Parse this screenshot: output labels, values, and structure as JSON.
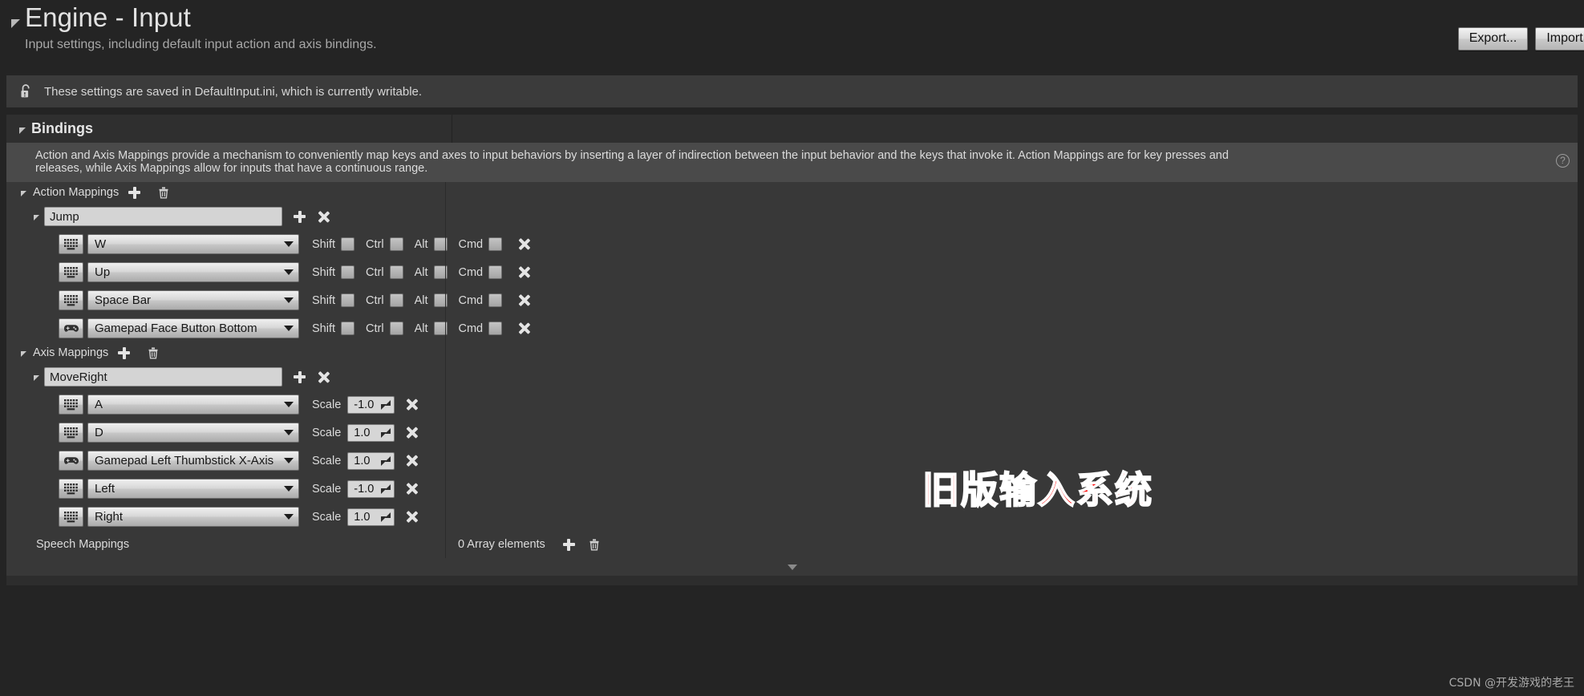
{
  "header": {
    "title": "Engine - Input",
    "subtitle": "Input settings, including default input action and axis bindings.",
    "export_label": "Export...",
    "import_label": "Import..."
  },
  "notice": {
    "text": "These settings are saved in DefaultInput.ini, which is currently writable.",
    "icon": "unlock-icon"
  },
  "bindings": {
    "section_label": "Bindings",
    "description": "Action and Axis Mappings provide a mechanism to conveniently map keys and axes to input behaviors by inserting a layer of indirection between the input behavior and the keys that invoke it. Action Mappings are for key presses and releases, while Axis Mappings allow for inputs that have a continuous range.",
    "help_icon": "help-circle-icon"
  },
  "action_mappings": {
    "label": "Action Mappings",
    "add_icon": "plus-icon",
    "delete_icon": "trash-icon",
    "groups": [
      {
        "name": "Jump",
        "add_icon": "plus-icon",
        "remove_icon": "x-icon",
        "bindings": [
          {
            "device": "keyboard-icon",
            "key": "W",
            "shift": false,
            "ctrl": false,
            "alt": false,
            "cmd": false
          },
          {
            "device": "keyboard-icon",
            "key": "Up",
            "shift": false,
            "ctrl": false,
            "alt": false,
            "cmd": false
          },
          {
            "device": "keyboard-icon",
            "key": "Space Bar",
            "shift": false,
            "ctrl": false,
            "alt": false,
            "cmd": false
          },
          {
            "device": "gamepad-icon",
            "key": "Gamepad Face Button Bottom",
            "shift": false,
            "ctrl": false,
            "alt": false,
            "cmd": false
          }
        ]
      }
    ],
    "modifier_labels": {
      "shift": "Shift",
      "ctrl": "Ctrl",
      "alt": "Alt",
      "cmd": "Cmd"
    }
  },
  "axis_mappings": {
    "label": "Axis Mappings",
    "add_icon": "plus-icon",
    "delete_icon": "trash-icon",
    "scale_label": "Scale",
    "groups": [
      {
        "name": "MoveRight",
        "add_icon": "plus-icon",
        "remove_icon": "x-icon",
        "bindings": [
          {
            "device": "keyboard-icon",
            "key": "A",
            "scale": "-1.0"
          },
          {
            "device": "keyboard-icon",
            "key": "D",
            "scale": "1.0"
          },
          {
            "device": "gamepad-icon",
            "key": "Gamepad Left Thumbstick X-Axis",
            "scale": "1.0"
          },
          {
            "device": "keyboard-icon",
            "key": "Left",
            "scale": "-1.0"
          },
          {
            "device": "keyboard-icon",
            "key": "Right",
            "scale": "1.0"
          }
        ]
      }
    ]
  },
  "speech_mappings": {
    "label": "Speech Mappings",
    "array_elements": "0 Array elements",
    "add_icon": "plus-icon",
    "delete_icon": "trash-icon"
  },
  "overlay": {
    "watermark": "旧版输入系统",
    "credit": "CSDN @开发游戏的老王"
  }
}
